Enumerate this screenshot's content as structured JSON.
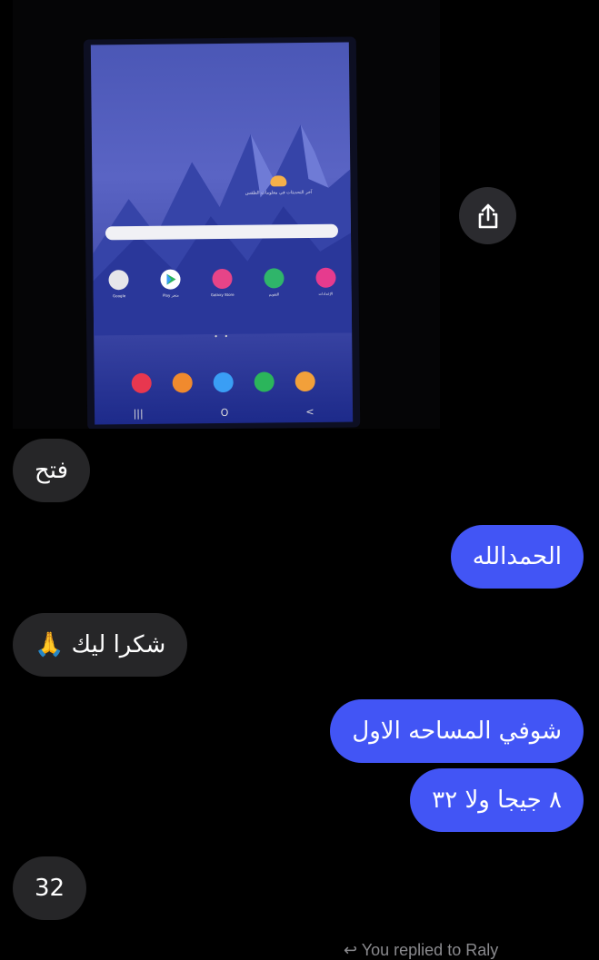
{
  "shared_photo": {
    "weather_text": "آخر التحديثات في معلومات الطقس",
    "home_apps": [
      {
        "label": "Google",
        "color": "#e6e6ea"
      },
      {
        "label": "Play متجر",
        "color": "#ffffff"
      },
      {
        "label": "Galaxy Store",
        "color": "#e64488"
      },
      {
        "label": "التقويم",
        "color": "#2fb56a"
      },
      {
        "label": "الإعدادات",
        "color": "#e63b8e"
      }
    ],
    "dock_apps": [
      {
        "name": "camera",
        "color": "#e8374f"
      },
      {
        "name": "contacts",
        "color": "#f08a2e"
      },
      {
        "name": "messages",
        "color": "#3a9ef5"
      },
      {
        "name": "phone",
        "color": "#2bb55b"
      },
      {
        "name": "email",
        "color": "#f2a03a"
      }
    ],
    "nav_buttons": [
      "|||",
      "O",
      "<"
    ]
  },
  "share_button": {
    "icon": "share-icon"
  },
  "messages": [
    {
      "direction": "incoming",
      "text": "فتح"
    },
    {
      "direction": "outgoing",
      "text": "الحمدالله"
    },
    {
      "direction": "incoming",
      "text": "شكرا ليك 🙏"
    },
    {
      "direction": "outgoing",
      "text": "شوفي المساحه الاول"
    },
    {
      "direction": "outgoing",
      "text": "٨ جيجا ولا ٣٢"
    },
    {
      "direction": "incoming",
      "text": "32"
    }
  ],
  "footer": {
    "reply_text": "You replied to Raly"
  },
  "colors": {
    "outgoing_bubble": "#4255f5",
    "incoming_bubble": "#262628",
    "background": "#000000"
  }
}
